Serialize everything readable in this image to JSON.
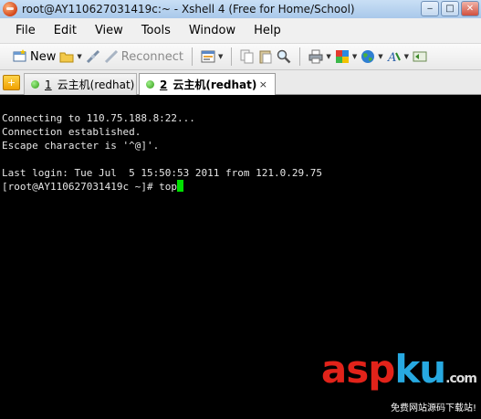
{
  "window": {
    "title": "root@AY110627031419c:~ - Xshell 4 (Free for Home/School)",
    "minimize_glyph": "‒",
    "maximize_glyph": "□",
    "close_glyph": "✕"
  },
  "menu": {
    "items": [
      "File",
      "Edit",
      "View",
      "Tools",
      "Window",
      "Help"
    ]
  },
  "toolbar": {
    "new_label": "New",
    "reconnect_label": "Reconnect",
    "icons": [
      "new-session-icon",
      "open-folder-icon",
      "disconnect-icon",
      "reconnect-icon",
      "properties-icon",
      "copy-icon",
      "paste-icon",
      "find-icon",
      "print-icon",
      "color-scheme-icon",
      "globe-icon",
      "font-icon",
      "more-icon"
    ]
  },
  "tabs": {
    "add_glyph": "+",
    "items": [
      {
        "number": "1",
        "title": "云主机(redhat)",
        "active": false
      },
      {
        "number": "2",
        "title": "云主机(redhat)",
        "active": true
      }
    ],
    "close_glyph": "×"
  },
  "terminal": {
    "lines": [
      "Connecting to 110.75.188.8:22...",
      "Connection established.",
      "Escape character is '^@]'.",
      "",
      "Last login: Tue Jul  5 15:50:53 2011 from 121.0.29.75",
      "[root@AY110627031419c ~]# top"
    ],
    "cursor_color": "#00e000"
  },
  "watermark": {
    "logo_part1": "asp",
    "logo_part2": "ku",
    "logo_suffix": ".com",
    "subtitle": "免费网站源码下载站!",
    "colors": {
      "part1": "#e2231a",
      "part2": "#27a9e1"
    }
  }
}
